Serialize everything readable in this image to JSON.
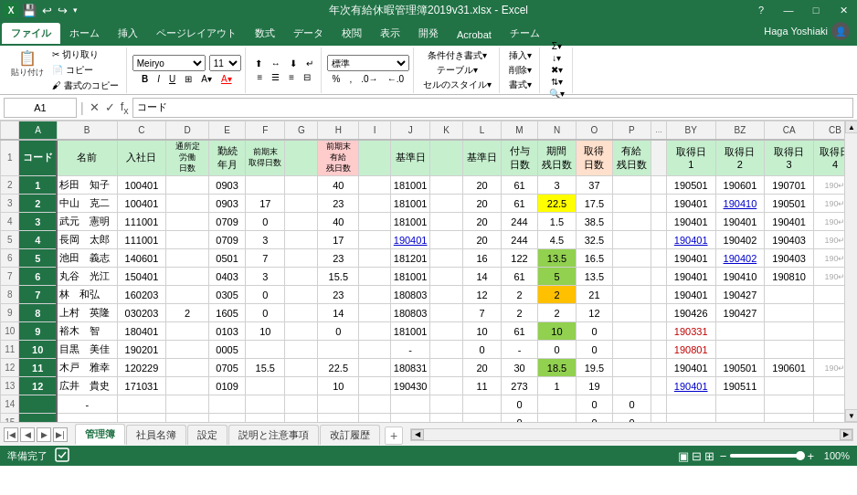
{
  "titleBar": {
    "title": "年次有給休暇管理簿2019v31.xlsx - Excel",
    "helpBtn": "?",
    "minBtn": "—",
    "maxBtn": "□",
    "closeBtn": "✕"
  },
  "quickAccess": {
    "icons": [
      "💾",
      "↩",
      "↪",
      "🖨",
      "🔍",
      "📋",
      "▾"
    ]
  },
  "ribbonTabs": [
    "ファイル",
    "ホーム",
    "挿入",
    "ページレイアウト",
    "数式",
    "データ",
    "校閲",
    "表示",
    "開発",
    "Acrobat",
    "チーム"
  ],
  "activeTab": "ファイル",
  "userLabel": "Haga Yoshiaki",
  "nameBox": "A1",
  "formulaContent": "コード",
  "columns": {
    "headers": [
      "A",
      "B",
      "C",
      "D",
      "E",
      "F",
      "G",
      "H",
      "I",
      "J",
      "K",
      "L",
      "M",
      "N",
      "O",
      "P",
      "...",
      "BY",
      "BZ",
      "CA",
      "CB"
    ],
    "widths": [
      42,
      65,
      60,
      55,
      45,
      45,
      45,
      50,
      45,
      45,
      45,
      45,
      45,
      45,
      45,
      45,
      20,
      55,
      55,
      55,
      55
    ]
  },
  "headerRow1": {
    "A": "コード",
    "B": "名前",
    "C": "入社日",
    "D": "通所定労働日数",
    "E": "勤続年月",
    "F": "前期末取得日数",
    "G": "",
    "H": "前期末有給残日数",
    "I": "",
    "J": "基準日",
    "K": "",
    "L": "基準日",
    "M": "付与日数",
    "N": "期間残日数",
    "O": "取得日数",
    "P": "有給残日数",
    "BY": "取得日1",
    "BZ": "取得日2",
    "CA": "取得日3",
    "CB": "取得日4"
  },
  "rows": [
    {
      "rowNum": "1",
      "A": "",
      "B": "",
      "C": "",
      "D": "",
      "E": "",
      "F": "",
      "G": "",
      "H": "",
      "I": "",
      "J": "",
      "K": "",
      "L": "",
      "M": "",
      "N": "",
      "O": "",
      "P": "",
      "BY": "",
      "BZ": "",
      "CA": "",
      "CB": ""
    },
    {
      "rowNum": "2",
      "A": "1",
      "B": "杉田　知子",
      "C": "100401",
      "D": "",
      "E": "0903",
      "F": "",
      "G": "",
      "H": "40",
      "I": "",
      "J": "181001",
      "K": "",
      "L": "20",
      "M": "61",
      "N": "3",
      "O": "37",
      "P": "",
      "BY": "190501",
      "BZ": "190601",
      "CA": "190701",
      "CB": "190↵"
    },
    {
      "rowNum": "3",
      "A": "2",
      "B": "中山　克二",
      "C": "100401",
      "D": "",
      "E": "0903",
      "F": "17",
      "G": "",
      "H": "23",
      "I": "",
      "J": "181001",
      "K": "",
      "L": "20",
      "M": "61",
      "N": "22.5",
      "O": "17.5",
      "P": "",
      "BY": "190401",
      "BZ": "190410",
      "CA": "190501",
      "CB": "190↵"
    },
    {
      "rowNum": "4",
      "A": "3",
      "B": "武元　憲明",
      "C": "111001",
      "D": "",
      "E": "0709",
      "F": "0",
      "G": "",
      "H": "40",
      "I": "",
      "J": "181001",
      "K": "",
      "L": "20",
      "M": "244",
      "N": "1.5",
      "O": "38.5",
      "P": "",
      "BY": "190401",
      "BZ": "190401",
      "CA": "190401",
      "CB": "190↵"
    },
    {
      "rowNum": "5",
      "A": "4",
      "B": "長岡　太郎",
      "C": "111001",
      "D": "",
      "E": "0709",
      "F": "3",
      "G": "",
      "H": "17",
      "I": "",
      "J": "190401",
      "K": "",
      "L": "20",
      "M": "244",
      "N": "4.5",
      "O": "32.5",
      "P": "",
      "BY": "190401",
      "BZ": "190402",
      "CA": "190403",
      "CB": "190↵"
    },
    {
      "rowNum": "6",
      "A": "5",
      "B": "池田　義志",
      "C": "140601",
      "D": "",
      "E": "0501",
      "F": "7",
      "G": "",
      "H": "23",
      "I": "",
      "J": "181201",
      "K": "",
      "L": "16",
      "M": "122",
      "N": "13.5",
      "O": "16.5",
      "P": "",
      "BY": "190401",
      "BZ": "190402",
      "CA": "190403",
      "CB": "190↵"
    },
    {
      "rowNum": "7",
      "A": "6",
      "B": "丸谷　光江",
      "C": "150401",
      "D": "",
      "E": "0403",
      "F": "3",
      "G": "",
      "H": "15.5",
      "I": "",
      "J": "181001",
      "K": "",
      "L": "14",
      "M": "61",
      "N": "5",
      "O": "13.5",
      "P": "",
      "BY": "190401",
      "BZ": "190410",
      "CA": "190810",
      "CB": "190↵"
    },
    {
      "rowNum": "8",
      "A": "7",
      "B": "林　和弘",
      "C": "160203",
      "D": "",
      "E": "0305",
      "F": "0",
      "G": "",
      "H": "23",
      "I": "",
      "J": "180803",
      "K": "",
      "L": "12",
      "M": "2",
      "N": "2",
      "O": "21",
      "P": "",
      "BY": "190401",
      "BZ": "190427",
      "CA": "",
      "CB": ""
    },
    {
      "rowNum": "9",
      "A": "8",
      "B": "上村　英隆",
      "C": "030203",
      "D": "2",
      "E": "1605",
      "F": "0",
      "G": "",
      "H": "14",
      "I": "",
      "J": "180803",
      "K": "",
      "L": "7",
      "M": "2",
      "N": "2",
      "O": "12",
      "P": "",
      "BY": "190426",
      "BZ": "190427",
      "CA": "",
      "CB": ""
    },
    {
      "rowNum": "10",
      "A": "9",
      "B": "裕木　智",
      "C": "180401",
      "D": "",
      "E": "0103",
      "F": "10",
      "G": "",
      "H": "0",
      "I": "",
      "J": "181001",
      "K": "",
      "L": "10",
      "M": "61",
      "N": "10",
      "O": "0",
      "P": "",
      "BY": "190331",
      "BZ": "",
      "CA": "",
      "CB": ""
    },
    {
      "rowNum": "11",
      "A": "10",
      "B": "目黒　美佳",
      "C": "190201",
      "D": "",
      "E": "0005",
      "F": "",
      "G": "",
      "H": "",
      "I": "",
      "J": "-",
      "K": "",
      "L": "0",
      "M": "-",
      "N": "0",
      "O": "0",
      "P": "",
      "BY": "190801",
      "BZ": "",
      "CA": "",
      "CB": ""
    },
    {
      "rowNum": "12",
      "A": "11",
      "B": "木戸　雅幸",
      "C": "120229",
      "D": "",
      "E": "0705",
      "F": "15.5",
      "G": "",
      "H": "22.5",
      "I": "",
      "J": "180831",
      "K": "",
      "L": "20",
      "M": "30",
      "N": "18.5",
      "O": "19.5",
      "P": "",
      "BY": "190401",
      "BZ": "190501",
      "CA": "190601",
      "CB": "190↵"
    },
    {
      "rowNum": "13",
      "A": "12",
      "B": "広井　貴史",
      "C": "171031",
      "D": "",
      "E": "0109",
      "F": "",
      "G": "",
      "H": "10",
      "I": "",
      "J": "190430",
      "K": "",
      "L": "11",
      "M": "273",
      "N": "1",
      "O": "19",
      "P": "",
      "BY": "190401",
      "BZ": "190511",
      "CA": "",
      "CB": ""
    },
    {
      "rowNum": "14",
      "A": "",
      "B": "-",
      "C": "",
      "D": "",
      "E": "",
      "F": "",
      "G": "",
      "H": "",
      "I": "",
      "J": "",
      "K": "",
      "L": "",
      "M": "0",
      "N": "",
      "O": "0",
      "P": "0",
      "BY": "",
      "BZ": "",
      "CA": "",
      "CB": ""
    },
    {
      "rowNum": "15",
      "A": "",
      "B": "-",
      "C": "",
      "D": "",
      "E": "",
      "F": "",
      "G": "",
      "H": "",
      "I": "",
      "J": "",
      "K": "",
      "L": "",
      "M": "0",
      "N": "",
      "O": "0",
      "P": "0",
      "BY": "",
      "BZ": "",
      "CA": "",
      "CB": ""
    }
  ],
  "sheetTabs": [
    "管理簿",
    "社員名簿",
    "設定",
    "説明と注意事項",
    "改訂履歴"
  ],
  "activeSheet": "管理簿",
  "statusBar": {
    "ready": "準備完了",
    "zoom": "100%"
  },
  "cellColors": {
    "O3": "yellow",
    "O6": "green",
    "O8": "orange",
    "N12": "green",
    "D5": "lightblue"
  }
}
